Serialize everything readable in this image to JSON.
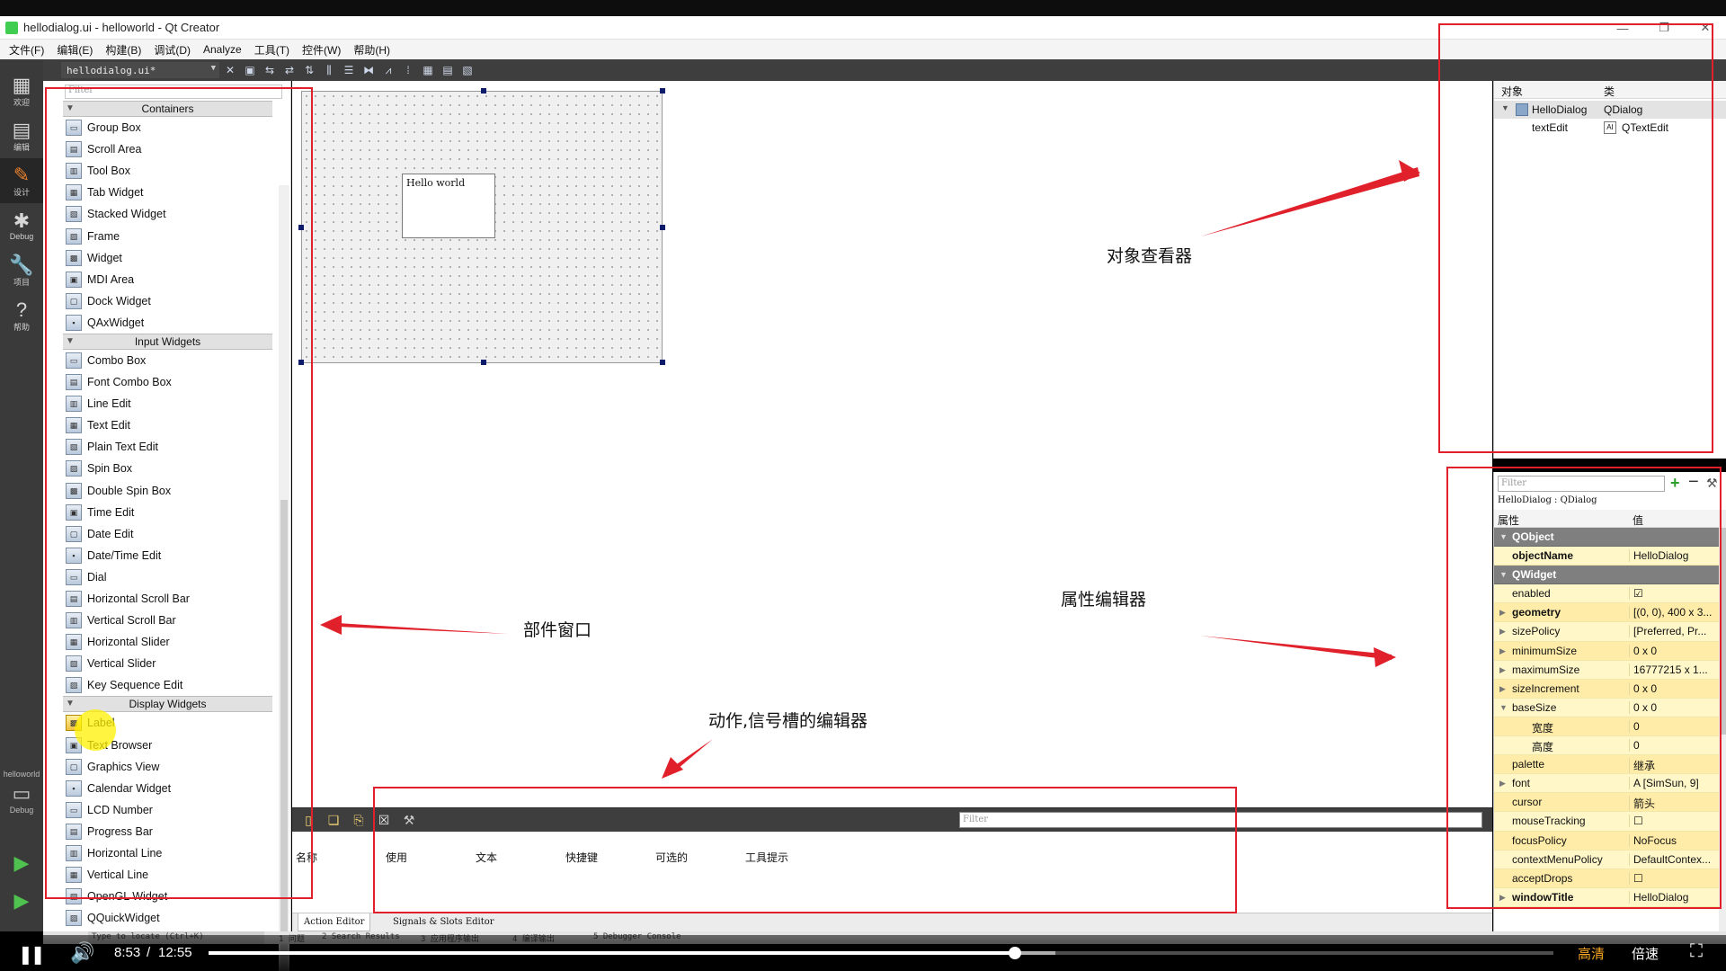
{
  "window": {
    "title": "hellodialog.ui - helloworld - Qt Creator"
  },
  "menubar": [
    "文件(F)",
    "编辑(E)",
    "构建(B)",
    "调试(D)",
    "Analyze",
    "工具(T)",
    "控件(W)",
    "帮助(H)"
  ],
  "modes": [
    {
      "label": "欢迎",
      "icon": "grid-icon"
    },
    {
      "label": "编辑",
      "icon": "edit-icon"
    },
    {
      "label": "设计",
      "icon": "pen-icon",
      "active": true
    },
    {
      "label": "Debug",
      "icon": "bug-icon"
    },
    {
      "label": "项目",
      "icon": "wrench-icon"
    },
    {
      "label": "帮助",
      "icon": "help-icon"
    }
  ],
  "kit": {
    "project": "helloworld",
    "mode": "Debug"
  },
  "editor_toolbar": {
    "document": "hellodialog.ui*"
  },
  "widget_box": {
    "filter_placeholder": "Filter",
    "categories": [
      {
        "name": "Containers",
        "items": [
          "Group Box",
          "Scroll Area",
          "Tool Box",
          "Tab Widget",
          "Stacked Widget",
          "Frame",
          "Widget",
          "MDI Area",
          "Dock Widget",
          "QAxWidget"
        ]
      },
      {
        "name": "Input Widgets",
        "items": [
          "Combo Box",
          "Font Combo Box",
          "Line Edit",
          "Text Edit",
          "Plain Text Edit",
          "Spin Box",
          "Double Spin Box",
          "Time Edit",
          "Date Edit",
          "Date/Time Edit",
          "Dial",
          "Horizontal Scroll Bar",
          "Vertical Scroll Bar",
          "Horizontal Slider",
          "Vertical Slider",
          "Key Sequence Edit"
        ]
      },
      {
        "name": "Display Widgets",
        "items": [
          "Label",
          "Text Browser",
          "Graphics View",
          "Calendar Widget",
          "LCD Number",
          "Progress Bar",
          "Horizontal Line",
          "Vertical Line",
          "OpenGL Widget",
          "QQuickWidget"
        ]
      }
    ]
  },
  "form": {
    "text_edit_content": "Hello world"
  },
  "action_editor": {
    "filter_placeholder": "Filter",
    "columns": [
      "名称",
      "使用",
      "文本",
      "快捷键",
      "可选的",
      "工具提示"
    ],
    "tabs": [
      "Action Editor",
      "Signals & Slots Editor"
    ]
  },
  "object_inspector": {
    "headers": [
      "对象",
      "类"
    ],
    "rows": [
      {
        "object": "HelloDialog",
        "class": "QDialog"
      },
      {
        "object": "textEdit",
        "class": "QTextEdit"
      }
    ]
  },
  "property_editor": {
    "filter_placeholder": "Filter",
    "class_label": "HelloDialog : QDialog",
    "headers": [
      "属性",
      "值"
    ],
    "rows": [
      {
        "type": "group",
        "name": "QObject"
      },
      {
        "name": "objectName",
        "value": "HelloDialog",
        "bold": true
      },
      {
        "type": "group",
        "name": "QWidget"
      },
      {
        "name": "enabled",
        "value": "☑"
      },
      {
        "name": "geometry",
        "value": "[(0, 0), 400 x 3...",
        "bold": true,
        "expandable": true
      },
      {
        "name": "sizePolicy",
        "value": "[Preferred, Pr...",
        "expandable": true
      },
      {
        "name": "minimumSize",
        "value": "0 x 0",
        "expandable": true
      },
      {
        "name": "maximumSize",
        "value": "16777215 x 1...",
        "expandable": true
      },
      {
        "name": "sizeIncrement",
        "value": "0 x 0",
        "expandable": true
      },
      {
        "name": "baseSize",
        "value": "0 x 0",
        "expanded": true
      },
      {
        "name": "宽度",
        "value": "0",
        "sub": true
      },
      {
        "name": "高度",
        "value": "0",
        "sub": true
      },
      {
        "name": "palette",
        "value": "继承"
      },
      {
        "name": "font",
        "value": "A  [SimSun, 9]",
        "expandable": true
      },
      {
        "name": "cursor",
        "value": "箭头"
      },
      {
        "name": "mouseTracking",
        "value": "☐"
      },
      {
        "name": "focusPolicy",
        "value": "NoFocus"
      },
      {
        "name": "contextMenuPolicy",
        "value": "DefaultContex..."
      },
      {
        "name": "acceptDrops",
        "value": "☐"
      },
      {
        "name": "windowTitle",
        "value": "HelloDialog",
        "bold": true,
        "expandable": true
      }
    ]
  },
  "statusbar": {
    "locator_placeholder": "Type to locate (Ctrl+K)",
    "panes": [
      "1 问题",
      "2 Search Results",
      "3 应用程序输出",
      "4 编译输出",
      "5 Debugger Console"
    ]
  },
  "annotations": {
    "object_inspector": "对象查看器",
    "property_editor": "属性编辑器",
    "widget_box": "部件窗口",
    "action_editor": "动作,信号槽的编辑器"
  },
  "player": {
    "current_time": "8:53",
    "separator": "/",
    "total_time": "12:55",
    "progress_fraction": 0.5995,
    "buffered_fraction": 0.63,
    "quality": "高清",
    "speed": "倍速"
  }
}
